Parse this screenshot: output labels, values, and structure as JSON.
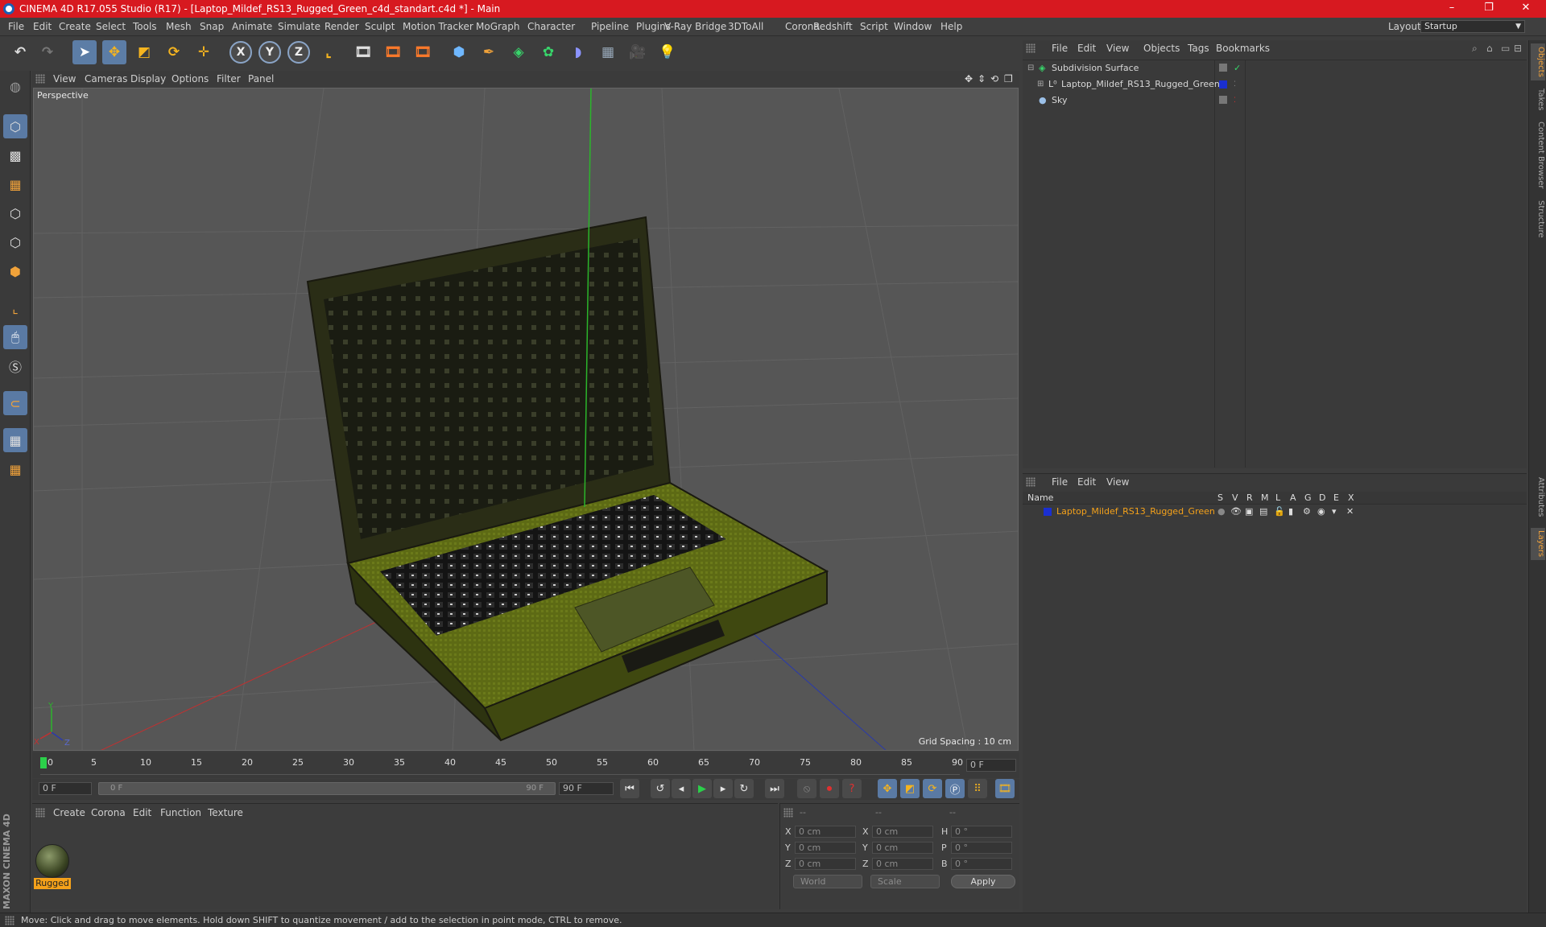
{
  "window": {
    "title": "CINEMA 4D R17.055 Studio (R17) - [Laptop_Mildef_RS13_Rugged_Green_c4d_standart.c4d *] - Main",
    "controls": [
      "–",
      "❐",
      "✕"
    ]
  },
  "menubar": {
    "items": [
      "File",
      "Edit",
      "Create",
      "Select",
      "Tools",
      "Mesh",
      "Snap",
      "Animate",
      "Simulate",
      "Render",
      "Sculpt",
      "Motion Tracker",
      "MoGraph",
      "Character",
      "Pipeline",
      "Plugins",
      "V-Ray Bridge",
      "3DToAll",
      "Corona",
      "Redshift",
      "Script",
      "Window",
      "Help"
    ],
    "layout_label": "Layout:",
    "layout_value": "Startup"
  },
  "toolbar": {
    "axis_labels": [
      "X",
      "Y",
      "Z"
    ]
  },
  "viewport": {
    "menu": [
      "View",
      "Cameras",
      "Display",
      "Options",
      "Filter",
      "Panel"
    ],
    "camera_label": "Perspective",
    "grid_spacing": "Grid Spacing : 10 cm",
    "axis_gizmo": [
      "Y",
      "X",
      "Z"
    ]
  },
  "timeline": {
    "ticks": [
      "0",
      "5",
      "10",
      "15",
      "20",
      "25",
      "30",
      "35",
      "40",
      "45",
      "50",
      "55",
      "60",
      "65",
      "70",
      "75",
      "80",
      "85",
      "90"
    ],
    "current_frame": "0 F",
    "start_field": "0 F",
    "range_start": "0 F",
    "range_end": "90 F",
    "end_field": "90 F"
  },
  "material_manager": {
    "menu": [
      "Create",
      "Corona",
      "Edit",
      "Function",
      "Texture"
    ],
    "material_name": "Rugged"
  },
  "coordinates": {
    "headers": [
      "--",
      "--",
      "--"
    ],
    "rows": [
      {
        "pos_label": "X",
        "pos": "0 cm",
        "size_label": "X",
        "size": "0 cm",
        "rot_label": "H",
        "rot": "0 °"
      },
      {
        "pos_label": "Y",
        "pos": "0 cm",
        "size_label": "Y",
        "size": "0 cm",
        "rot_label": "P",
        "rot": "0 °"
      },
      {
        "pos_label": "Z",
        "pos": "0 cm",
        "size_label": "Z",
        "size": "0 cm",
        "rot_label": "B",
        "rot": "0 °"
      }
    ],
    "mode_select": "World",
    "scale_select": "Scale",
    "apply_label": "Apply"
  },
  "object_manager": {
    "menu": [
      "File",
      "Edit",
      "View",
      "Objects",
      "Tags",
      "Bookmarks"
    ],
    "objects": [
      {
        "name": "Subdivision Surface"
      },
      {
        "name": "Laptop_Mildef_RS13_Rugged_Green"
      },
      {
        "name": "Sky"
      }
    ]
  },
  "layer_manager": {
    "menu": [
      "File",
      "Edit",
      "View"
    ],
    "columns": [
      "Name",
      "S",
      "V",
      "R",
      "M",
      "L",
      "A",
      "G",
      "D",
      "E",
      "X"
    ],
    "layer_name": "Laptop_Mildef_RS13_Rugged_Green",
    "layer_color": "#1a2fd1"
  },
  "side_tabs": [
    "Objects",
    "Takes",
    "Content Browser",
    "Structure",
    "Attributes",
    "Layers"
  ],
  "branding": "MAXON CINEMA 4D",
  "status": "Move: Click and drag to move elements. Hold down SHIFT to quantize movement / add to the selection in point mode, CTRL to remove.",
  "colors": {
    "title_bar": "#d71920",
    "active_tool": "#5c7da6",
    "material_label": "#f4a11a",
    "layer_highlight": "#f4a11a",
    "laptop_body": "#5d6a14"
  }
}
